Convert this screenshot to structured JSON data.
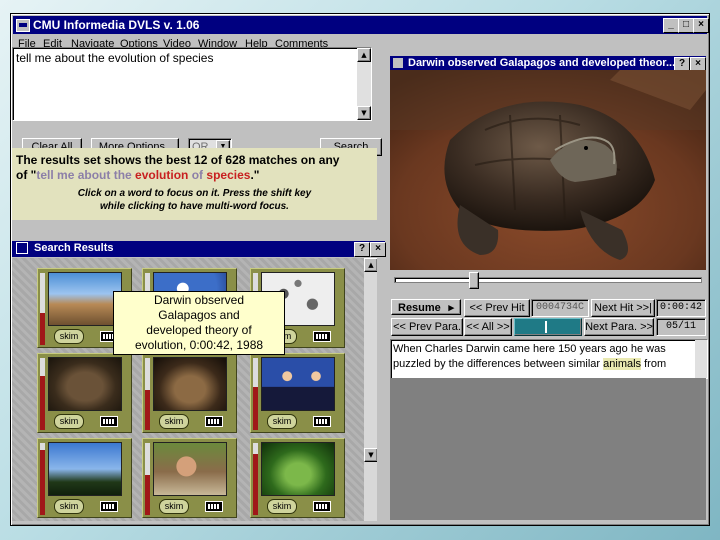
{
  "window": {
    "title": "CMU Informedia DVLS  v. 1.06",
    "minimize": "_",
    "maximize": "□",
    "close": "×"
  },
  "menu": [
    "File",
    "Edit",
    "Navigate",
    "Options",
    "Video",
    "Window",
    "Help",
    "Comments"
  ],
  "query": {
    "value": "tell me about the evolution of species"
  },
  "query_buttons": {
    "clear": "Clear All",
    "more": "More Options..",
    "mode": "OR",
    "search": "Search"
  },
  "results_info": {
    "line1": "The results set shows the best 12 of 628 matches on any",
    "line2_prefix": "of \"",
    "q1": "tell me about the ",
    "q2": "evolution",
    "q3": " of ",
    "q4": "species",
    "line2_suffix": ".\"",
    "hint1": "Click on a word to focus on it.  Press the shift key",
    "hint2": "while clicking to have multi-word focus."
  },
  "search_results": {
    "title": "Search Results",
    "help": "?",
    "close": "×",
    "skim_label": "skim",
    "tooltip": [
      "Darwin observed",
      "Galapagos and",
      "developed theory of",
      "evolution, 0:00:42, 1988"
    ],
    "relevance": [
      0.45,
      0.35,
      0.5,
      0.75,
      0.55,
      0.6,
      0.9,
      0.55,
      0.85
    ]
  },
  "video": {
    "title": "Darwin observed Galapagos and developed theor...",
    "help": "?",
    "close": "×",
    "position": 0.25
  },
  "controls": {
    "resume": "Resume",
    "resume_arrow": "▸",
    "prev_hit": "<< Prev Hit",
    "timecode": "0004734C",
    "next_hit": "Next Hit >>|",
    "time": "0:00:42",
    "prev_para": "<< Prev Para.",
    "all": "<< All >>",
    "next_para": "Next Para. >>",
    "para_count": "05/11"
  },
  "transcript": {
    "line1": "When Charles Darwin came here 150 years ago he was",
    "line2_before": "puzzled by the differences between similar ",
    "line2_highlight": "animals",
    "line2_after": " from"
  },
  "colors": {
    "title_bar": "#000080",
    "cell": "#8a8f48",
    "highlight_red": "#c82020",
    "highlight_muted": "#8c7fa8"
  }
}
